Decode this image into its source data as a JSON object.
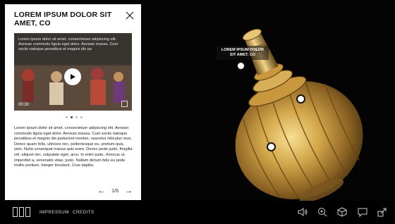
{
  "panel": {
    "title": "LOREM IPSUM DOLOR SIT AMET, CO",
    "video": {
      "description": "Lorem ipsum dolor sit amet, consectetuer adipiscing elit. Aenean commodo ligula eget dolor. Aenean massa. Cum sociis natoque penatibus et magnis dis pa",
      "time": "00:30"
    },
    "body": "Lorem ipsum dolor sit amet, consectetuer adipiscing elit. Aenean commodo ligula eget dolor. Aenean massa. Cum sociis natoque penatibus et magnis dis parturient montes, nascetur ridiculus mus. Donec quam felis, ultricies nec, pellentesque eu, pretium quis, sem. Nulla consequat massa quis enim. Donec pede justo, fringilla vel, aliquet nec, vulputate eget, arcu. In enim justo, rhoncus ut, imperdiet a, venenatis vitae, justo. Nullam dictum felis eu pede mollis pretium. Integer tincidunt. Cras dapibu",
    "pager": "1/6"
  },
  "hotspot": {
    "label": "LOREM IPSUM DOLOR SIT AMET, CO"
  },
  "nav": {
    "impressum": "IMPRESSUM",
    "credits": "CREDITS"
  },
  "icons": {
    "close": "close-icon",
    "play": "play-icon",
    "menu": "grid-menu-icon",
    "audio": "speaker-icon",
    "zoom": "zoom-in-icon",
    "model": "cube-icon",
    "comment": "speech-bubble-icon",
    "share": "share-icon"
  },
  "colors": {
    "background": "#040404",
    "gold": "#b58a3a",
    "panel": "#ffffff"
  }
}
